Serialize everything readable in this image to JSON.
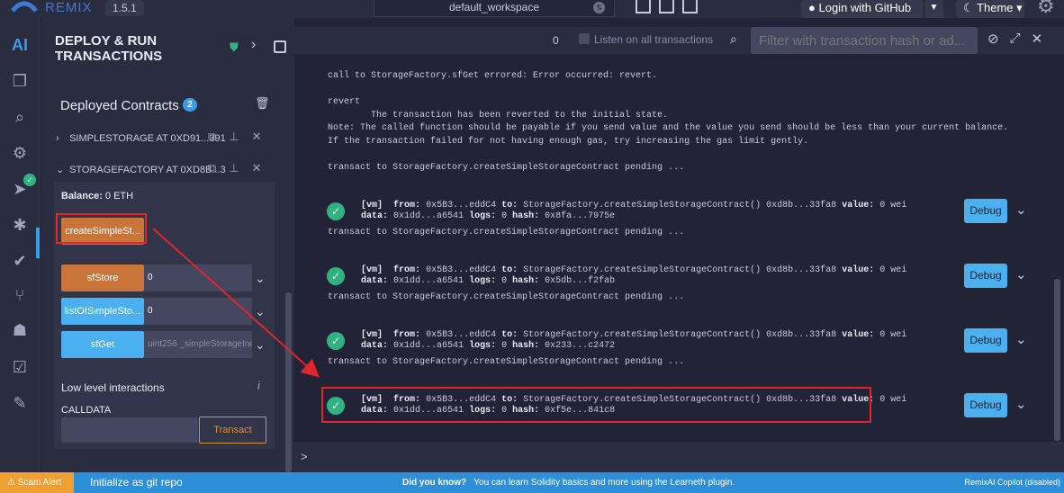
{
  "topbar": {
    "brand": "REMIX",
    "version": "1.5.1",
    "workspace": "default_workspace",
    "login_label": "Login with GitHub",
    "theme_label": "Theme"
  },
  "panel": {
    "title": "DEPLOY & RUN TRANSACTIONS",
    "deployed_label": "Deployed Contracts",
    "deployed_count": "2",
    "contracts": [
      {
        "name": "SIMPLESTORAGE AT 0XD91...391",
        "expanded": false
      },
      {
        "name": "STORAGEFACTORY AT 0XD8B...3",
        "expanded": true
      }
    ],
    "balance_label": "Balance:",
    "balance_value": "0 ETH",
    "functions": [
      {
        "label": "createSimpleSt...",
        "color": "orange",
        "input": ""
      },
      {
        "label": "sfStore",
        "color": "orange",
        "input": "0"
      },
      {
        "label": "listOfSimpleSto...",
        "color": "blue",
        "input": "0"
      },
      {
        "label": "sfGet",
        "color": "blue",
        "input": "uint256 _simpleStorageInde"
      }
    ],
    "low_level_label": "Low level interactions",
    "calldata_label": "CALLDATA",
    "transact_label": "Transact"
  },
  "terminal": {
    "counter": "0",
    "listen_label": "Listen on all transactions",
    "filter_placeholder": "Filter with transaction hash or ad...",
    "lines": [
      {
        "text": "call to StorageFactory.sfGet errored: Error occurred: revert."
      },
      {
        "text": "revert"
      },
      {
        "text": "        The transaction has been reverted to the initial state."
      },
      {
        "text": "Note: The called function should be payable if you send value and the value you send should be less than your current balance."
      },
      {
        "text": "If the transaction failed for not having enough gas, try increasing the gas limit gently."
      },
      {
        "text": "transact to StorageFactory.createSimpleStorageContract pending ..."
      }
    ],
    "transactions": [
      {
        "from": "0x5B3...eddC4",
        "to": "StorageFactory.createSimpleStorageContract() 0xd8b...33fa8",
        "value": "0 wei",
        "data": "0x1dd...a6541",
        "logs": "0",
        "hash": "0x8fa...7975e",
        "pending": "transact to StorageFactory.createSimpleStorageContract pending ..."
      },
      {
        "from": "0x5B3...eddC4",
        "to": "StorageFactory.createSimpleStorageContract() 0xd8b...33fa8",
        "value": "0 wei",
        "data": "0x1dd...a6541",
        "logs": "0",
        "hash": "0x5db...f2fab",
        "pending": "transact to StorageFactory.createSimpleStorageContract pending ..."
      },
      {
        "from": "0x5B3...eddC4",
        "to": "StorageFactory.createSimpleStorageContract() 0xd8b...33fa8",
        "value": "0 wei",
        "data": "0x1dd...a6541",
        "logs": "0",
        "hash": "0x233...c2472",
        "pending": "transact to StorageFactory.createSimpleStorageContract pending ..."
      },
      {
        "from": "0x5B3...eddC4",
        "to": "StorageFactory.createSimpleStorageContract() 0xd8b...33fa8",
        "value": "0 wei",
        "data": "0x1dd...a6541",
        "logs": "0",
        "hash": "0xf5e...841c8",
        "pending": ""
      }
    ],
    "debug_label": "Debug",
    "prompt": ">"
  },
  "statusbar": {
    "scam_alert": "Scam Alert",
    "git_init": "Initialize as git repo",
    "tip_title": "Did you know?",
    "tip_text": "You can learn Solidity basics and more using the Learneth plugin.",
    "copilot": "RemixAI Copilot (disabled)"
  },
  "colors": {
    "accent": "#3b9ce8",
    "orange_button": "#c97539",
    "blue_button": "#4ab0f0",
    "success": "#2fb380",
    "highlight": "#e0262c"
  }
}
